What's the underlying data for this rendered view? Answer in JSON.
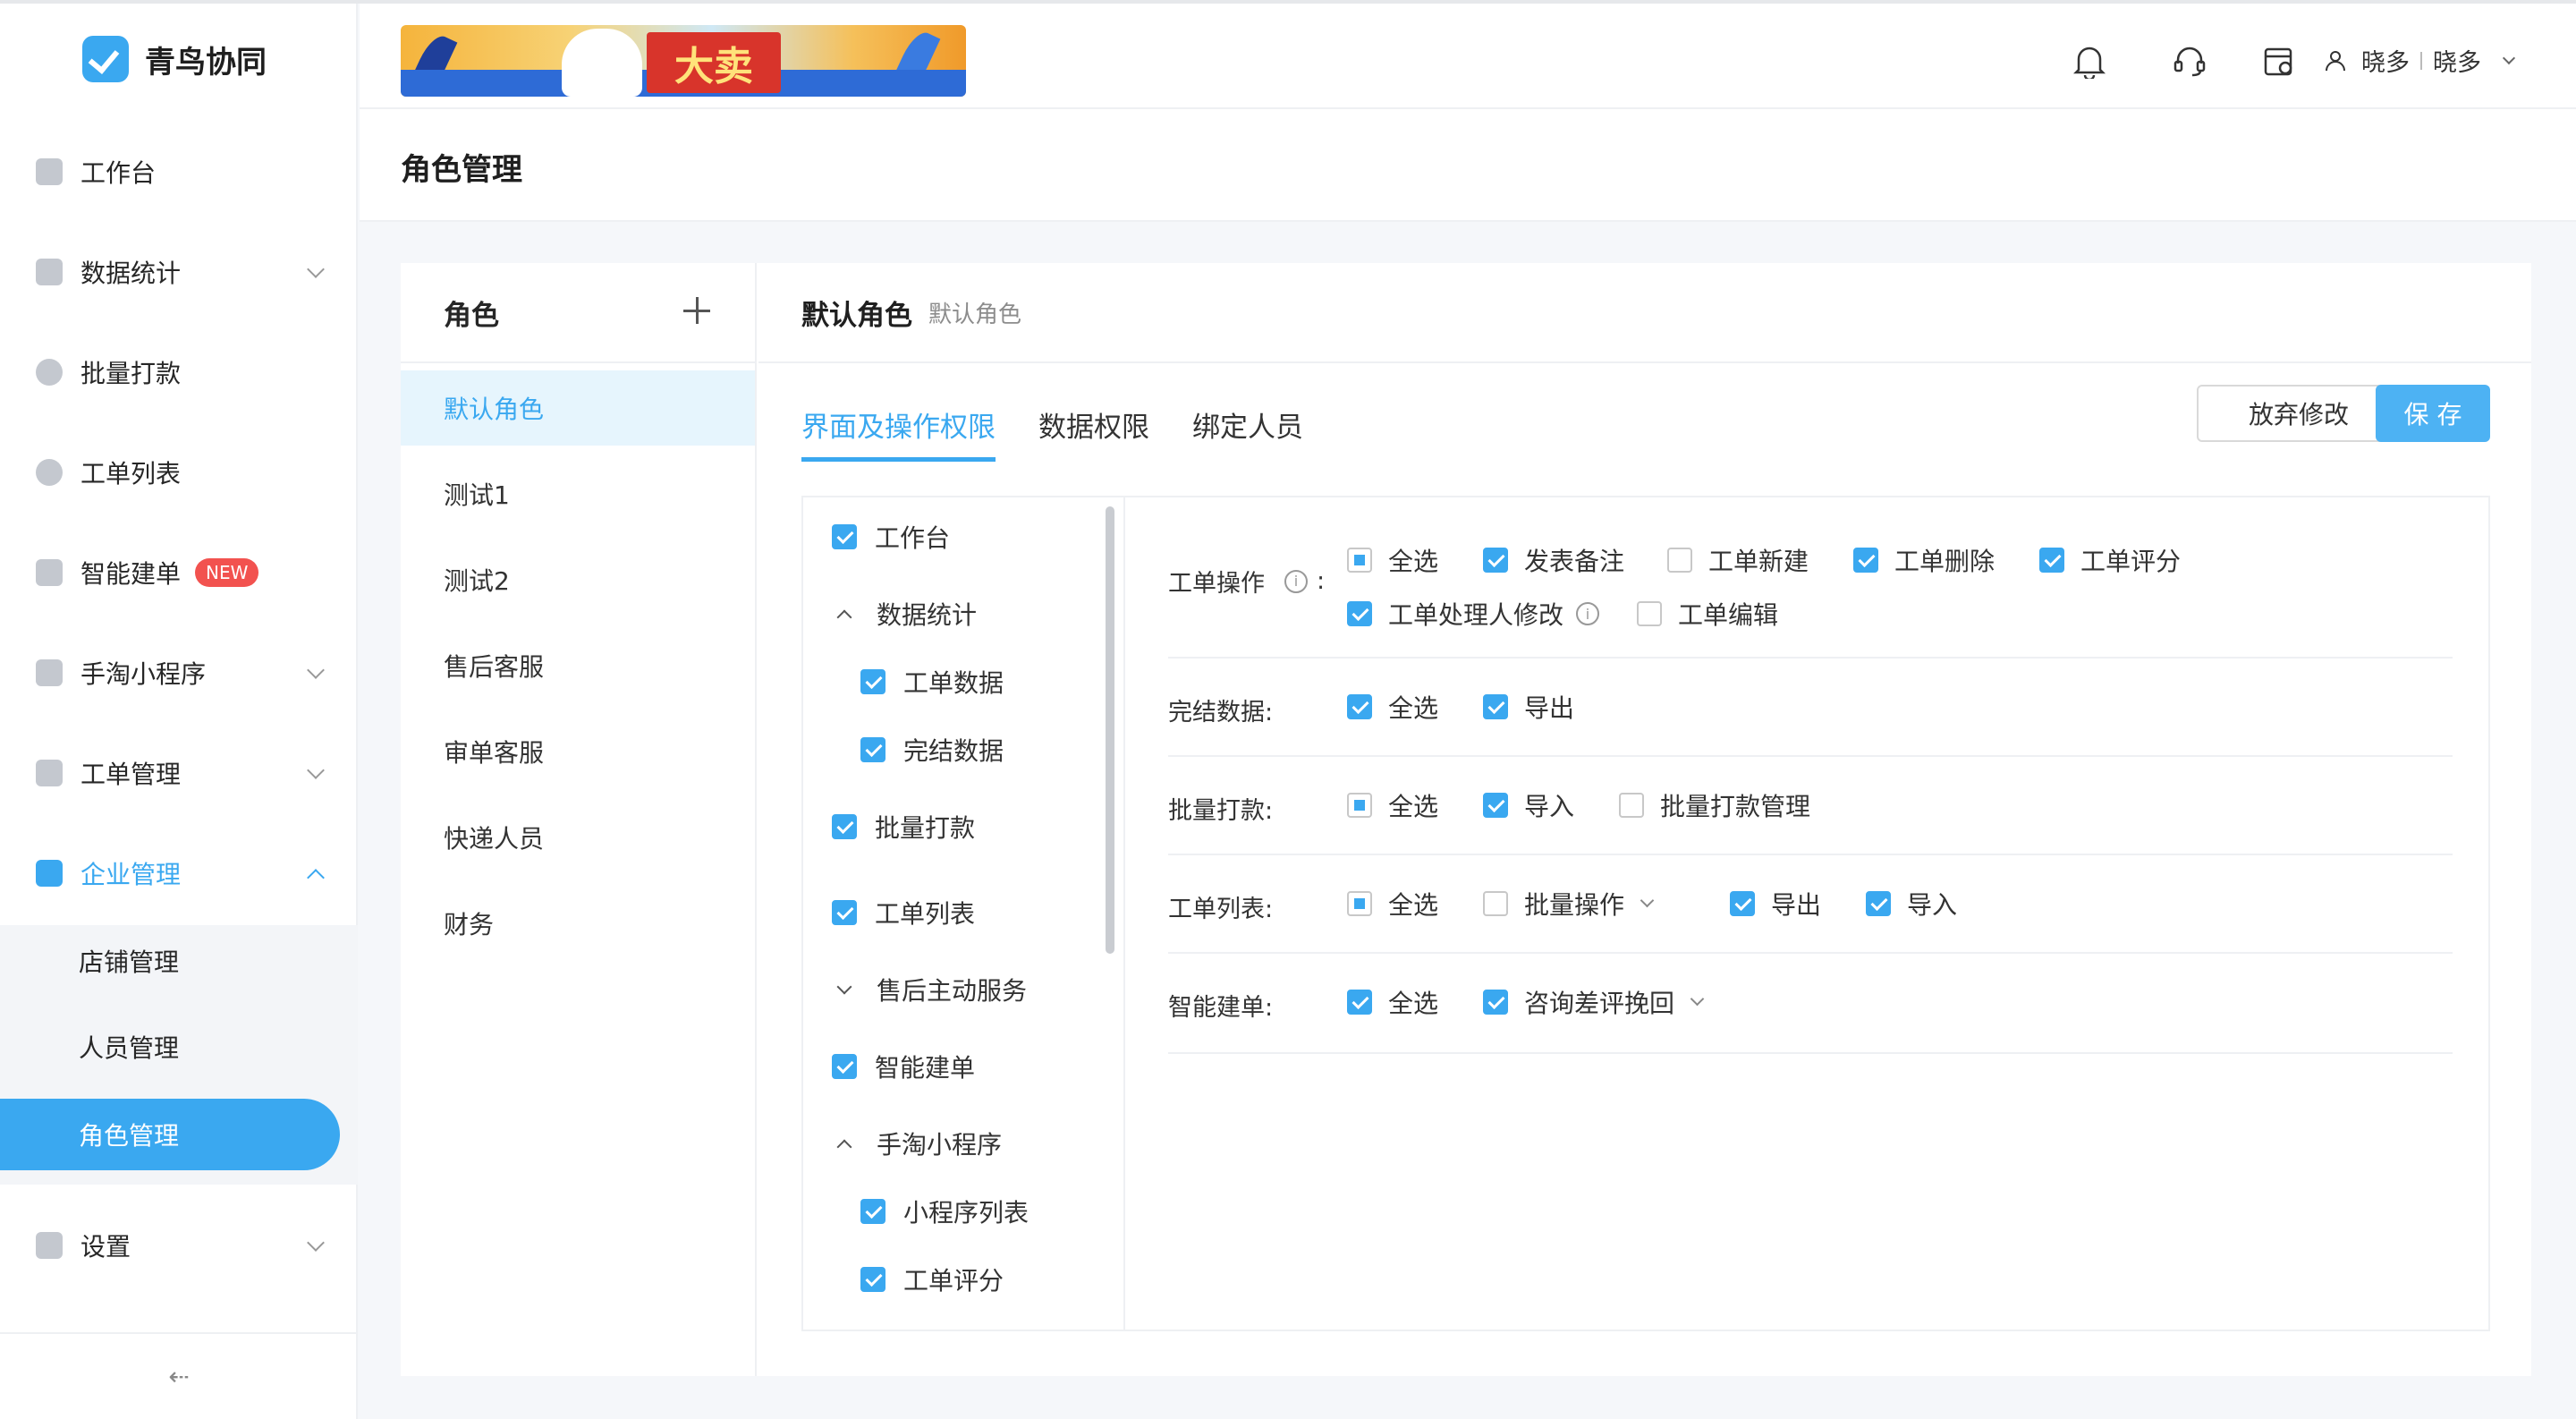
{
  "app": {
    "name": "青鸟协同"
  },
  "sidebar": {
    "items": [
      {
        "label": "工作台"
      },
      {
        "label": "数据统计"
      },
      {
        "label": "批量打款"
      },
      {
        "label": "工单列表"
      },
      {
        "label": "智能建单",
        "badge": "NEW"
      },
      {
        "label": "手淘小程序"
      },
      {
        "label": "工单管理"
      },
      {
        "label": "企业管理"
      },
      {
        "label": "设置"
      }
    ],
    "sub_items": [
      {
        "label": "店铺管理"
      },
      {
        "label": "人员管理"
      },
      {
        "label": "角色管理"
      }
    ],
    "collapse_icon": "⇠"
  },
  "header": {
    "banner_text": "大卖",
    "user": {
      "name": "晓多",
      "org": "晓多"
    }
  },
  "page": {
    "title": "角色管理"
  },
  "roles": {
    "heading": "角色",
    "items": [
      "默认角色",
      "测试1",
      "测试2",
      "售后客服",
      "审单客服",
      "快递人员",
      "财务"
    ]
  },
  "detail": {
    "role_name": "默认角色",
    "role_desc": "默认角色",
    "tabs": [
      "界面及操作权限",
      "数据权限",
      "绑定人员"
    ],
    "discard_label": "放弃修改",
    "save_label": "保 存"
  },
  "tree": [
    {
      "label": "工作台",
      "state": "on",
      "level": 0
    },
    {
      "label": "数据统计",
      "state": "expanded",
      "level": 0
    },
    {
      "label": "工单数据",
      "state": "on",
      "level": 1
    },
    {
      "label": "完结数据",
      "state": "on",
      "level": 1
    },
    {
      "label": "批量打款",
      "state": "on",
      "level": 0
    },
    {
      "label": "工单列表",
      "state": "on",
      "level": 0
    },
    {
      "label": "售后主动服务",
      "state": "collapsed",
      "level": 0
    },
    {
      "label": "智能建单",
      "state": "on",
      "level": 0
    },
    {
      "label": "手淘小程序",
      "state": "expanded",
      "level": 0
    },
    {
      "label": "小程序列表",
      "state": "on",
      "level": 1
    },
    {
      "label": "工单评分",
      "state": "on",
      "level": 1
    }
  ],
  "permissions": [
    {
      "label": "工单操作",
      "colon": ":",
      "options": [
        {
          "label": "全选",
          "state": "half"
        },
        {
          "label": "发表备注",
          "state": "on"
        },
        {
          "label": "工单新建",
          "state": "off"
        },
        {
          "label": "工单删除",
          "state": "on"
        },
        {
          "label": "工单评分",
          "state": "on"
        },
        {
          "label": "工单处理人修改",
          "state": "on"
        },
        {
          "label": "工单编辑",
          "state": "off"
        }
      ]
    },
    {
      "label": "完结数据:",
      "options": [
        {
          "label": "全选",
          "state": "on"
        },
        {
          "label": "导出",
          "state": "on"
        }
      ]
    },
    {
      "label": "批量打款:",
      "options": [
        {
          "label": "全选",
          "state": "half"
        },
        {
          "label": "导入",
          "state": "on"
        },
        {
          "label": "批量打款管理",
          "state": "off"
        }
      ]
    },
    {
      "label": "工单列表:",
      "options": [
        {
          "label": "全选",
          "state": "half"
        },
        {
          "label": "批量操作",
          "state": "off"
        },
        {
          "label": "导出",
          "state": "on"
        },
        {
          "label": "导入",
          "state": "on"
        }
      ]
    },
    {
      "label": "智能建单:",
      "options": [
        {
          "label": "全选",
          "state": "on"
        },
        {
          "label": "咨询差评挽回",
          "state": "on"
        }
      ]
    }
  ],
  "info_glyph": "i",
  "colors": {
    "accent": "#3aa8f0",
    "badge": "#f2524f"
  }
}
